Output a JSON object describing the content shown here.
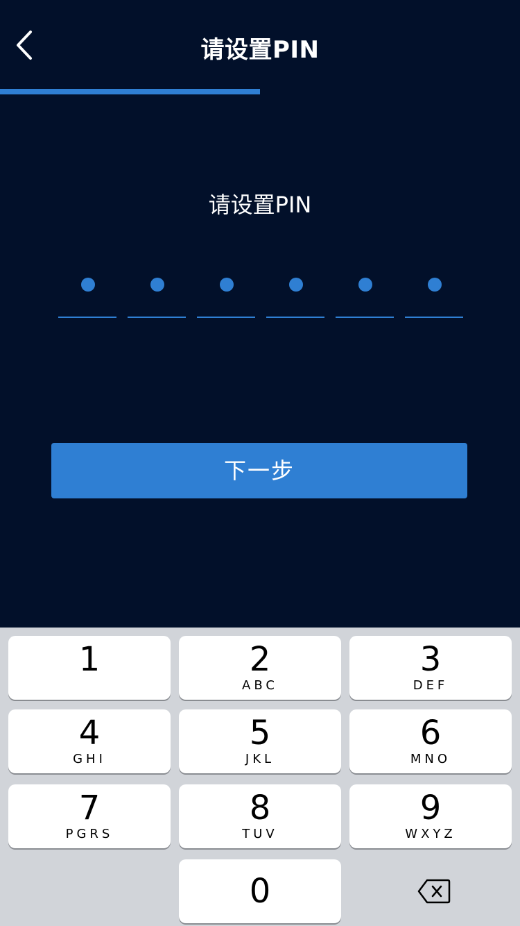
{
  "nav": {
    "title": "请设置PIN",
    "back_icon": "chevron-left-icon"
  },
  "progress": {
    "fraction": 0.5,
    "color": "#2f7fd3"
  },
  "prompt": "请设置PIN",
  "pin": {
    "length": 6,
    "filled": 6
  },
  "next_button": {
    "label": "下一步"
  },
  "keyboard": {
    "keys": [
      {
        "num": "1",
        "letters": ""
      },
      {
        "num": "2",
        "letters": "ABC"
      },
      {
        "num": "3",
        "letters": "DEF"
      },
      {
        "num": "4",
        "letters": "GHI"
      },
      {
        "num": "5",
        "letters": "JKL"
      },
      {
        "num": "6",
        "letters": "MNO"
      },
      {
        "num": "7",
        "letters": "PGRS"
      },
      {
        "num": "8",
        "letters": "TUV"
      },
      {
        "num": "9",
        "letters": "WXYZ"
      },
      {
        "num": "0",
        "letters": ""
      }
    ],
    "delete_icon": "backspace-icon"
  },
  "colors": {
    "background": "#02102a",
    "accent": "#2f7fd3",
    "keyboard_bg": "#d1d4d9"
  }
}
